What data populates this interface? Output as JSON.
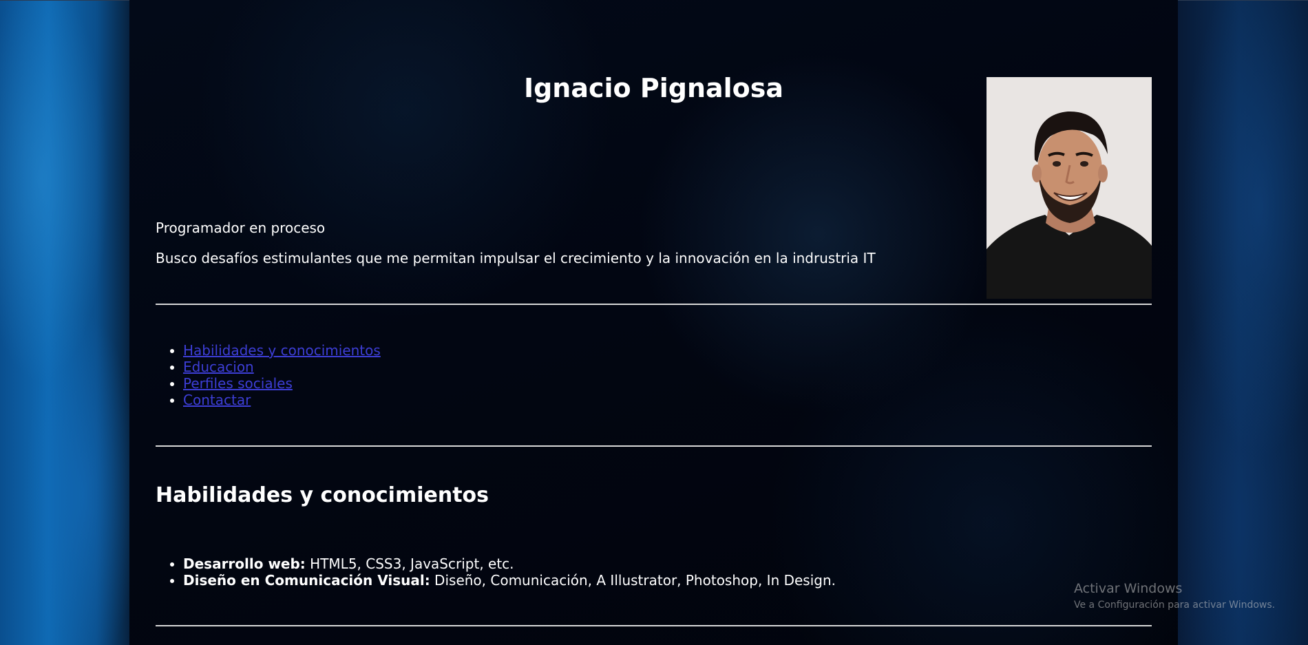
{
  "header": {
    "name": "Ignacio Pignalosa"
  },
  "intro": {
    "role": "Programador en proceso",
    "objective": "Busco desafíos estimulantes que me permitan impulsar el crecimiento y la innovación en la indrustria IT"
  },
  "nav": {
    "items": [
      {
        "label": "Habilidades y conocimientos"
      },
      {
        "label": "Educacion"
      },
      {
        "label": "Perfiles sociales"
      },
      {
        "label": "Contactar"
      }
    ]
  },
  "skills": {
    "heading": "Habilidades y conocimientos",
    "items": [
      {
        "title": "Desarrollo web:",
        "detail": " HTML5, CSS3, JavaScript, etc."
      },
      {
        "title": "Diseño en Comunicación Visual:",
        "detail": " Diseño, Comunicación, A Illustrator, Photoshop, In Design."
      }
    ]
  },
  "watermark": {
    "title": "Activar Windows",
    "subtitle": "Ve a Configuración para activar Windows."
  },
  "colors": {
    "link": "#3d3ed6",
    "text": "#ffffff",
    "divider": "#d9d9d9",
    "panel_background": "#020814"
  },
  "icons": {
    "profile_photo": "profile-photo-portrait"
  }
}
